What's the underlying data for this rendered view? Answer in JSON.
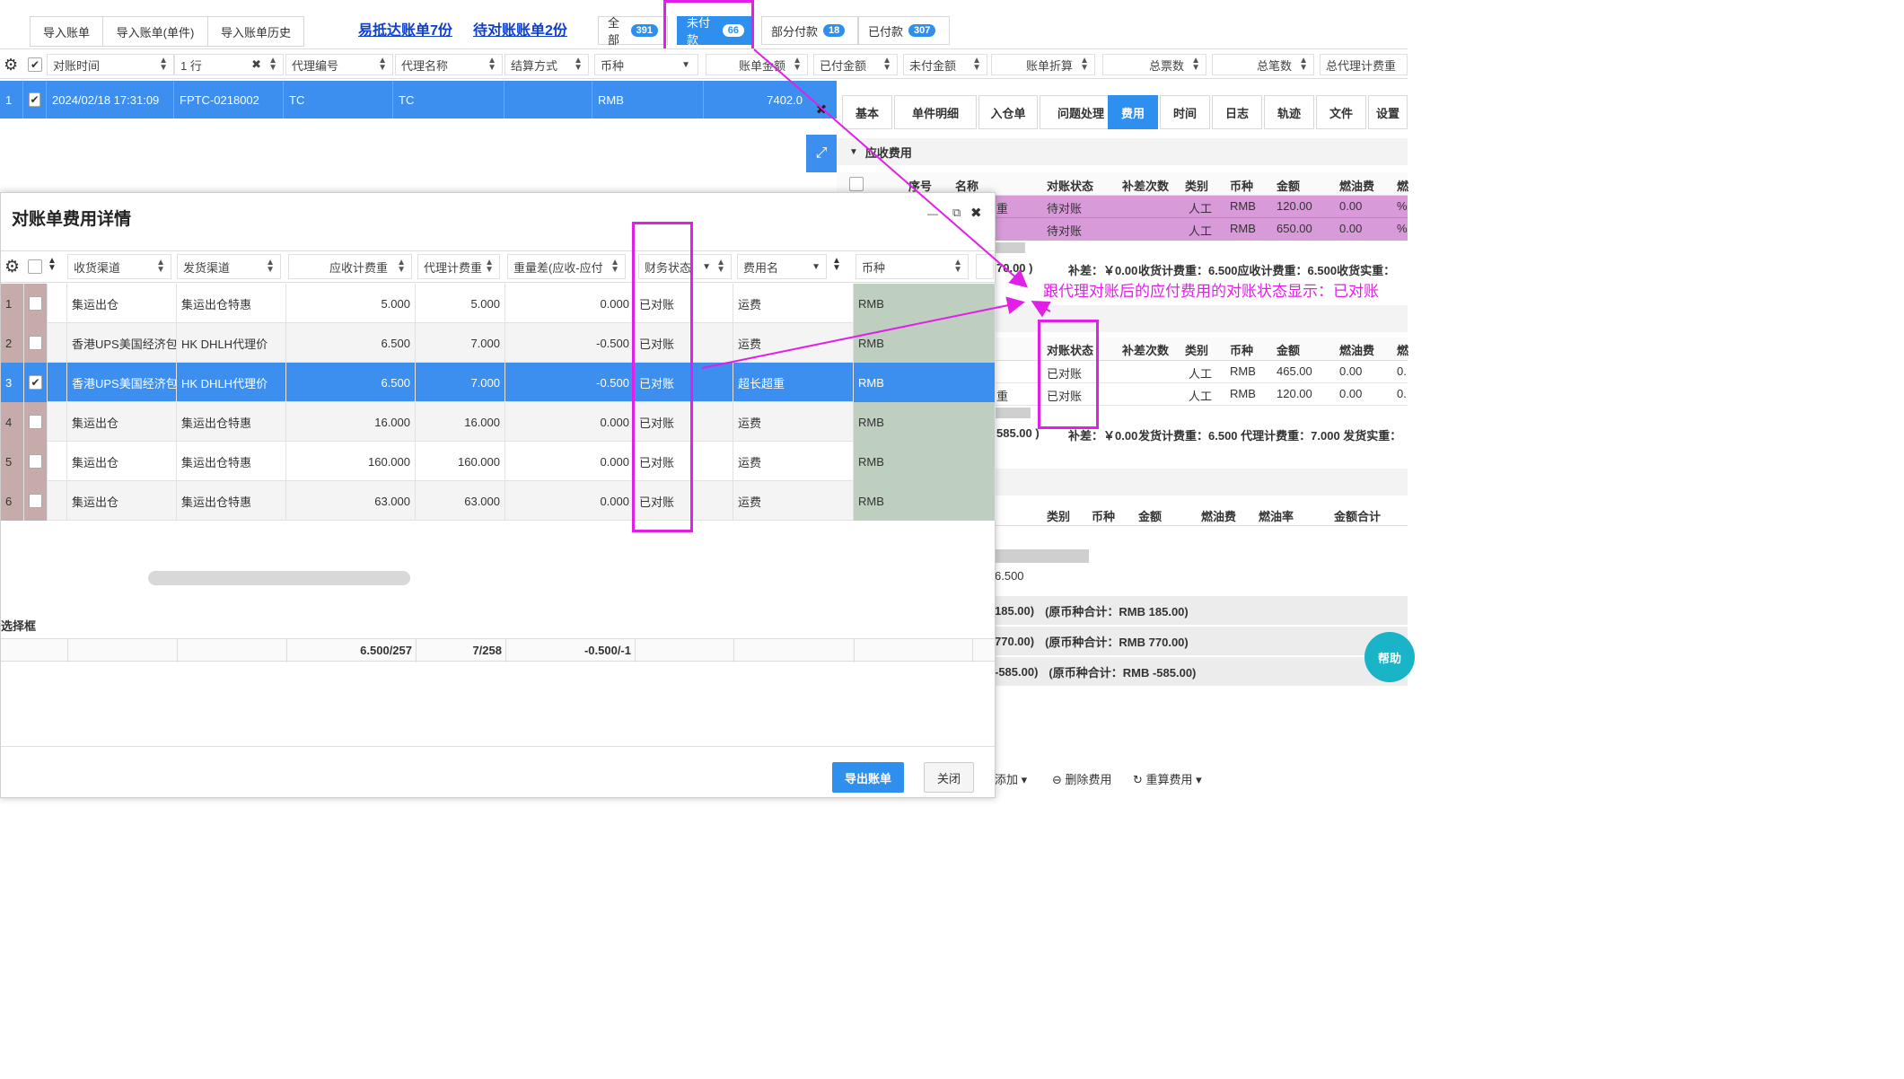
{
  "toolbar": {
    "buttons": [
      "导入账单",
      "导入账单(单件)",
      "导入账单历史"
    ],
    "link1": "易抵达账单7份",
    "link2": "待对账账单2份"
  },
  "status_tabs": [
    {
      "label": "全部",
      "count": "391"
    },
    {
      "label": "未付款",
      "count": "66"
    },
    {
      "label": "部分付款",
      "count": "18"
    },
    {
      "label": "已付款",
      "count": "307"
    }
  ],
  "grid": {
    "columns": [
      "对账时间",
      "1 行",
      "代理编号",
      "代理名称",
      "结算方式",
      "币种",
      "账单金额",
      "已付金额",
      "未付金额",
      "账单折算",
      "总票数",
      "总笔数",
      "总代理计费重"
    ],
    "row": {
      "index": "1",
      "time": "2024/02/18 17:31:09",
      "code": "FPTC-0218002",
      "agent_no": "TC",
      "agent_name": "TC",
      "settle": "",
      "currency": "RMB",
      "amount": "7402.0"
    }
  },
  "right_panel": {
    "tabs": [
      "基本",
      "单件明细",
      "入仓单",
      "问题处理",
      "费用",
      "时间",
      "日志",
      "轨迹",
      "文件",
      "设置"
    ],
    "section1": "应收费用",
    "table1_header": [
      "序号",
      "名称",
      "对账状态",
      "补差次数",
      "类别",
      "币种",
      "金额",
      "燃油费",
      "燃"
    ],
    "table1_rows": [
      {
        "name": "重",
        "status": "待对账",
        "cat": "人工",
        "cur": "RMB",
        "amt": "120.00",
        "fuel": "0.00",
        "extra": "%"
      },
      {
        "name": "",
        "status": "待对账",
        "cat": "人工",
        "cur": "RMB",
        "amt": "650.00",
        "fuel": "0.00",
        "extra": "%"
      }
    ],
    "summary1": {
      "left": "70.00 )",
      "bucha": "补差：￥0.00",
      "text": "收货计费重：6.500应收计费重：6.500收货实重："
    },
    "annotation": "跟代理对账后的应付费用的对账状态显示：已对账",
    "table2_header": [
      "对账状态",
      "补差次数",
      "类别",
      "币种",
      "金额",
      "燃油费",
      "燃"
    ],
    "table2_rows": [
      {
        "name": "",
        "status": "已对账",
        "cat": "人工",
        "cur": "RMB",
        "amt": "465.00",
        "fuel": "0.00",
        "extra": "0."
      },
      {
        "name": "重",
        "status": "已对账",
        "cat": "人工",
        "cur": "RMB",
        "amt": "120.00",
        "fuel": "0.00",
        "extra": "0."
      }
    ],
    "summary2": {
      "left": "585.00 )",
      "bucha": "补差：￥0.00",
      "text": "发货计费重：6.500 代理计费重：7.000 发货实重："
    },
    "table3_header": [
      "类别",
      "币种",
      "金额",
      "燃油费",
      "燃油率",
      "金额合计"
    ],
    "value_6500": "6.500",
    "totals": [
      {
        "a": "185.00)",
        "b": "(原币种合计：RMB 185.00)"
      },
      {
        "a": "770.00)",
        "b": "(原币种合计：RMB 770.00)"
      },
      {
        "a": "-585.00)",
        "b": "(原币种合计：RMB -585.00)"
      }
    ],
    "help": "帮助",
    "bottom_actions": [
      "添加",
      "删除费用",
      "重算费用"
    ]
  },
  "modal": {
    "title": "对账单费用详情",
    "columns": [
      "收货渠道",
      "发货渠道",
      "应收计费重",
      "代理计费重",
      "重量差(应收-应付",
      "财务状态",
      "费用名",
      "币种"
    ],
    "rows": [
      {
        "idx": "1",
        "checked": false,
        "recv": "集运出仓",
        "send": "集运出仓特惠",
        "w1": "5.000",
        "w2": "5.000",
        "diff": "0.000",
        "status": "已对账",
        "fee": "运费",
        "cur": "RMB"
      },
      {
        "idx": "2",
        "checked": false,
        "recv": "香港UPS美国经济包",
        "send": "HK DHLH代理价",
        "w1": "6.500",
        "w2": "7.000",
        "diff": "-0.500",
        "status": "已对账",
        "fee": "运费",
        "cur": "RMB"
      },
      {
        "idx": "3",
        "checked": true,
        "recv": "香港UPS美国经济包",
        "send": "HK DHLH代理价",
        "w1": "6.500",
        "w2": "7.000",
        "diff": "-0.500",
        "status": "已对账",
        "fee": "超长超重",
        "cur": "RMB"
      },
      {
        "idx": "4",
        "checked": false,
        "recv": "集运出仓",
        "send": "集运出仓特惠",
        "w1": "16.000",
        "w2": "16.000",
        "diff": "0.000",
        "status": "已对账",
        "fee": "运费",
        "cur": "RMB"
      },
      {
        "idx": "5",
        "checked": false,
        "recv": "集运出仓",
        "send": "集运出仓特惠",
        "w1": "160.000",
        "w2": "160.000",
        "diff": "0.000",
        "status": "已对账",
        "fee": "运费",
        "cur": "RMB"
      },
      {
        "idx": "6",
        "checked": false,
        "recv": "集运出仓",
        "send": "集运出仓特惠",
        "w1": "63.000",
        "w2": "63.000",
        "diff": "0.000",
        "status": "已对账",
        "fee": "运费",
        "cur": "RMB"
      }
    ],
    "selector_label": "选择框",
    "footer_totals": {
      "w1": "6.500/257",
      "w2": "7/258",
      "diff": "-0.500/-1"
    },
    "export_button": "导出账单",
    "close_button": "关闭"
  },
  "colors": {
    "accent": "#2f8fef",
    "highlight": "#e11fe6",
    "pending_row": "#d89ad8",
    "currency_col": "#bfcfbf"
  }
}
